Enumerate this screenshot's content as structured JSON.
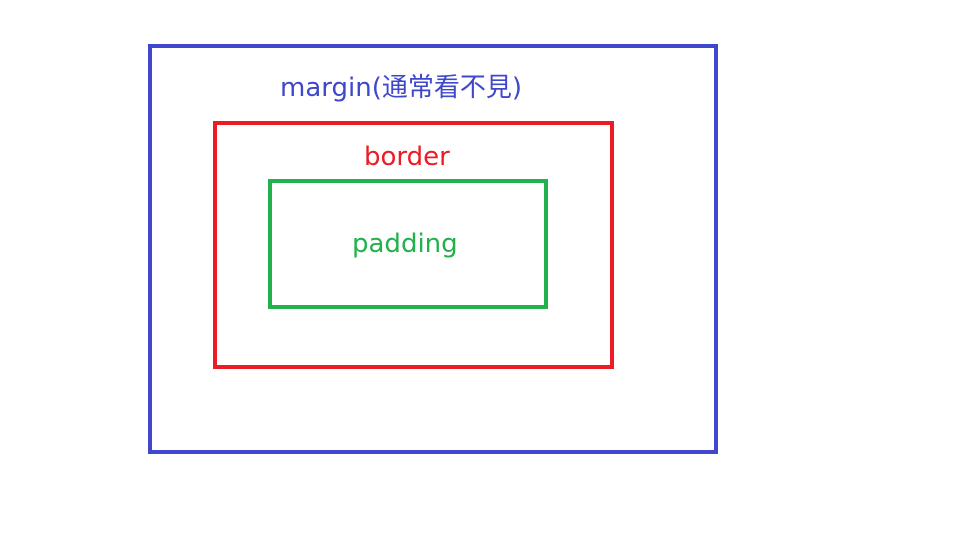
{
  "colors": {
    "margin": "#3f48cc",
    "border": "#ed1c24",
    "padding": "#22b14c"
  },
  "diagram": {
    "margin_label": "margin(通常看不見)",
    "border_label": "border",
    "padding_label": "padding"
  }
}
